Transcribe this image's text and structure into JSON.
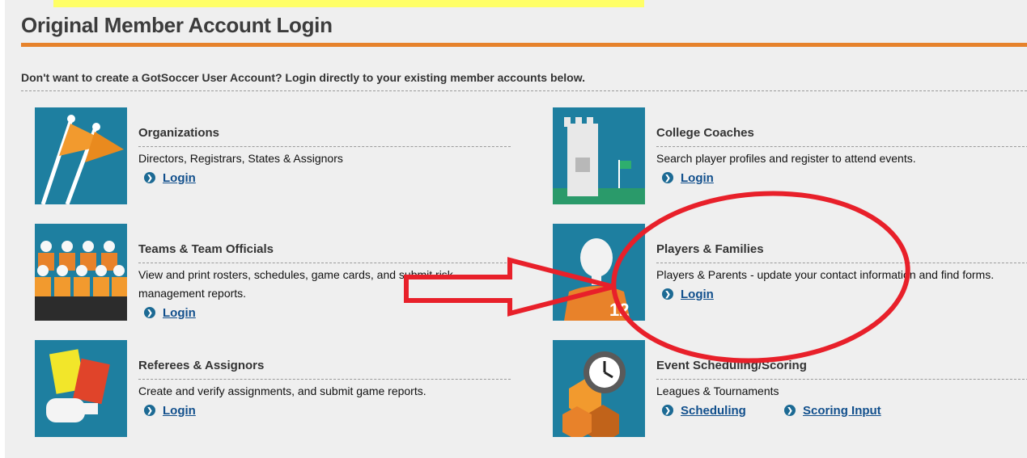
{
  "header": {
    "title": "Original Member Account Login",
    "intro": "Don't want to create a GotSoccer User Account? Login directly to your existing member accounts below."
  },
  "cards": [
    {
      "title": "Organizations",
      "desc": "Directors, Registrars, States & Assignors",
      "links": [
        "Login"
      ]
    },
    {
      "title": "College Coaches",
      "desc": "Search player profiles and register to attend events.",
      "links": [
        "Login"
      ]
    },
    {
      "title": "Teams & Team Officials",
      "desc": "View and print rosters, schedules, game cards, and submit risk management reports.",
      "links": [
        "Login"
      ]
    },
    {
      "title": "Players & Families",
      "desc": "Players & Parents - update your contact information and find forms.",
      "links": [
        "Login"
      ]
    },
    {
      "title": "Referees & Assignors",
      "desc": "Create and verify assignments, and submit game reports.",
      "links": [
        "Login"
      ]
    },
    {
      "title": "Event Scheduling/Scoring",
      "desc": "Leagues & Tournaments",
      "links": [
        "Scheduling",
        "Scoring Input"
      ]
    }
  ],
  "thumbs": {
    "player_number": "12"
  },
  "colors": {
    "accent_orange": "#e6822b",
    "thumb_blue": "#1e7fa0",
    "link_blue": "#114f8c",
    "annotation_red": "#e8202a",
    "highlight_yellow": "#ffff66"
  },
  "icons": [
    "chevron-right-icon",
    "flags-icon",
    "castle-icon",
    "team-icon",
    "player-icon",
    "cards-whistle-icon",
    "clock-icon"
  ]
}
